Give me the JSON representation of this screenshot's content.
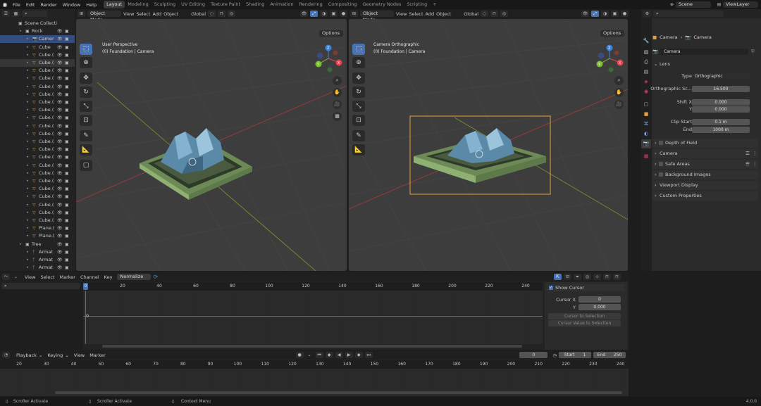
{
  "topbar": {
    "menu": [
      "File",
      "Edit",
      "Render",
      "Window",
      "Help"
    ],
    "workspaces": [
      "Layout",
      "Modeling",
      "Sculpting",
      "UV Editing",
      "Texture Paint",
      "Shading",
      "Animation",
      "Rendering",
      "Compositing",
      "Geometry Nodes",
      "Scripting"
    ],
    "active_workspace": "Layout",
    "add_tab": "+",
    "scene": "Scene",
    "view_layer": "ViewLayer"
  },
  "outliner": {
    "search_placeholder": "",
    "rows": [
      {
        "label": "Scene Collecti",
        "icon": "collection-icon",
        "depth": 0,
        "state": "none",
        "vis": false
      },
      {
        "label": "Rock",
        "icon": "collection-icon",
        "depth": 1,
        "state": "none",
        "vis": true
      },
      {
        "label": "Camer",
        "icon": "camera-icon",
        "depth": 2,
        "state": "active",
        "vis": true
      },
      {
        "label": "Cube",
        "icon": "mesh-icon",
        "depth": 2,
        "state": "none",
        "vis": true
      },
      {
        "label": "Cube.(",
        "icon": "mesh-icon",
        "depth": 2,
        "state": "none",
        "vis": true
      },
      {
        "label": "Cube.(",
        "icon": "mesh-icon",
        "depth": 2,
        "state": "selected",
        "vis": true
      },
      {
        "label": "Cube.(",
        "icon": "mesh-icon",
        "depth": 2,
        "state": "none",
        "vis": true
      },
      {
        "label": "Cube.(",
        "icon": "mesh-icon",
        "depth": 2,
        "state": "none",
        "vis": true
      },
      {
        "label": "Cube.(",
        "icon": "mesh-icon",
        "depth": 2,
        "state": "none",
        "vis": true
      },
      {
        "label": "Cube.(",
        "icon": "mesh-icon",
        "depth": 2,
        "state": "none",
        "vis": true
      },
      {
        "label": "Cube.(",
        "icon": "mesh-icon",
        "depth": 2,
        "state": "none",
        "vis": true
      },
      {
        "label": "Cube.(",
        "icon": "mesh-icon",
        "depth": 2,
        "state": "none",
        "vis": true
      },
      {
        "label": "Cube.(",
        "icon": "mesh-icon",
        "depth": 2,
        "state": "none",
        "vis": true
      },
      {
        "label": "Cube.(",
        "icon": "mesh-icon",
        "depth": 2,
        "state": "none",
        "vis": true
      },
      {
        "label": "Cube.(",
        "icon": "mesh-icon",
        "depth": 2,
        "state": "none",
        "vis": true
      },
      {
        "label": "Cube.(",
        "icon": "mesh-icon",
        "depth": 2,
        "state": "none",
        "vis": true
      },
      {
        "label": "Cube.(",
        "icon": "mesh-icon",
        "depth": 2,
        "state": "none",
        "vis": true
      },
      {
        "label": "Cube.(",
        "icon": "mesh-icon",
        "depth": 2,
        "state": "none",
        "vis": true
      },
      {
        "label": "Cube.(",
        "icon": "mesh-icon",
        "depth": 2,
        "state": "none",
        "vis": true
      },
      {
        "label": "Cube.(",
        "icon": "mesh-icon",
        "depth": 2,
        "state": "none",
        "vis": true
      },
      {
        "label": "Cube.(",
        "icon": "mesh-icon",
        "depth": 2,
        "state": "none",
        "vis": true
      },
      {
        "label": "Cube.(",
        "icon": "mesh-icon",
        "depth": 2,
        "state": "none",
        "vis": true
      },
      {
        "label": "Cube.(",
        "icon": "mesh-icon",
        "depth": 2,
        "state": "none",
        "vis": true
      },
      {
        "label": "Cube.(",
        "icon": "mesh-icon",
        "depth": 2,
        "state": "none",
        "vis": true
      },
      {
        "label": "Cube.(",
        "icon": "mesh-icon",
        "depth": 2,
        "state": "none",
        "vis": true
      },
      {
        "label": "Cube.(",
        "icon": "mesh-icon",
        "depth": 2,
        "state": "none",
        "vis": true
      },
      {
        "label": "Plane.(",
        "icon": "mesh-icon",
        "depth": 2,
        "state": "none",
        "vis": true
      },
      {
        "label": "Plane.(",
        "icon": "mesh-icon",
        "depth": 2,
        "state": "none",
        "vis": true
      },
      {
        "label": "Tree",
        "icon": "collection-icon",
        "depth": 1,
        "state": "none",
        "vis": true
      },
      {
        "label": "Armat",
        "icon": "armature-icon",
        "depth": 2,
        "state": "none",
        "vis": true
      },
      {
        "label": "Armat",
        "icon": "armature-icon",
        "depth": 2,
        "state": "none",
        "vis": true
      },
      {
        "label": "Armat",
        "icon": "armature-icon",
        "depth": 2,
        "state": "none",
        "vis": true
      },
      {
        "label": "Armat",
        "icon": "armature-icon",
        "depth": 2,
        "state": "none",
        "vis": true
      }
    ]
  },
  "viewport_left": {
    "mode": "Object Mode",
    "menus": [
      "View",
      "Select",
      "Add",
      "Object"
    ],
    "orientation": "Global",
    "view_name": "User Perspective",
    "collection_info": "(0) Foundation | Camera",
    "options": "Options"
  },
  "viewport_right": {
    "mode": "Object Mode",
    "menus": [
      "View",
      "Select",
      "Add",
      "Object"
    ],
    "orientation": "Global",
    "view_name": "Camera Orthographic",
    "collection_info": "(0) Foundation | Camera",
    "options": "Options"
  },
  "properties": {
    "breadcrumb_obj": "Camera",
    "breadcrumb_data": "Camera",
    "datablock": "Camera",
    "lens_title": "Lens",
    "type_label": "Type",
    "type_value": "Orthographic",
    "ortho_label": "Orthographic Sc...",
    "ortho_value": "16.500",
    "shift_x_label": "Shift X",
    "shift_x_value": "0.000",
    "shift_y_label": "Y",
    "shift_y_value": "0.000",
    "clip_start_label": "Clip Start",
    "clip_start_value": "0.1 m",
    "clip_end_label": "End",
    "clip_end_value": "1000 m",
    "panels": [
      "Depth of Field",
      "Camera",
      "Safe Areas",
      "Background Images",
      "Viewport Display",
      "Custom Properties"
    ]
  },
  "graph_editor": {
    "menus": [
      "View",
      "Select",
      "Marker",
      "Channel",
      "Key"
    ],
    "normalize": "Normalize",
    "ticks": [
      "20",
      "40",
      "60",
      "80",
      "100",
      "120",
      "140",
      "160",
      "180",
      "200",
      "220",
      "240"
    ],
    "current_frame_marker": "0",
    "row_value": "0",
    "show_cursor": "Show Cursor",
    "cursor_x_label": "Cursor X",
    "cursor_x_value": "0",
    "cursor_y_label": "Y",
    "cursor_y_value": "0.000",
    "cursor_to_selection": "Cursor to Selection",
    "cursor_value_to_selection": "Cursor Value to Selection"
  },
  "timeline": {
    "menus": [
      "Playback",
      "Keying",
      "View",
      "Marker"
    ],
    "current_frame": "0",
    "start_label": "Start",
    "start_value": "1",
    "end_label": "End",
    "end_value": "250",
    "ticks": [
      "20",
      "30",
      "40",
      "50",
      "60",
      "70",
      "80",
      "90",
      "100",
      "110",
      "120",
      "130",
      "140",
      "150",
      "160",
      "170",
      "180",
      "190",
      "200",
      "210",
      "220",
      "230",
      "240"
    ]
  },
  "statusbar": {
    "items": [
      "Scroller Activate",
      "Scroller Activate",
      "Context Menu"
    ],
    "version": "4.0.0"
  },
  "colors": {
    "accent": "#4772b3",
    "camera_frame": "#e8a33a",
    "axis_x": "#a83a3a",
    "axis_y": "#7a9a2a",
    "gizmo_x": "#e6414c",
    "gizmo_y": "#7fbf36",
    "gizmo_z": "#3b82e0"
  }
}
